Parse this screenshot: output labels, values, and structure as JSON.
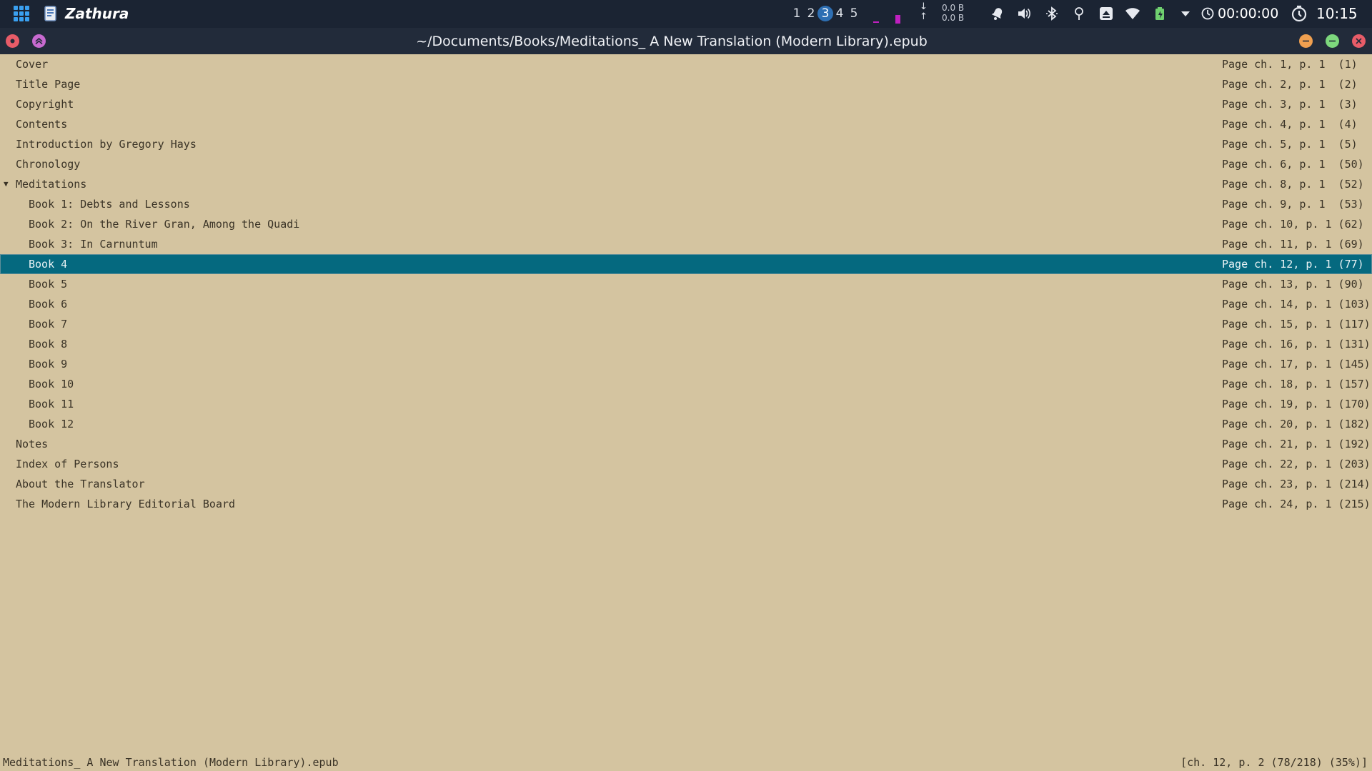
{
  "panel": {
    "app_name": "Zathura",
    "workspaces": [
      {
        "label": "1",
        "active": false
      },
      {
        "label": "2",
        "active": false
      },
      {
        "label": "3",
        "active": true
      },
      {
        "label": "4",
        "active": false
      },
      {
        "label": "5",
        "active": false
      }
    ],
    "net_down": "0.0 B",
    "net_up": "0.0 B",
    "timer": "00:00:00",
    "clock": "10:15",
    "tray_icons": [
      "notification-bell-icon",
      "volume-icon",
      "bluetooth-icon",
      "location-icon",
      "storage-icon",
      "wifi-icon",
      "battery-icon",
      "tray-expand-icon"
    ]
  },
  "window": {
    "title": "~/Documents/Books/Meditations_ A New Translation (Modern Library).epub",
    "colors": {
      "close": "#e85c68",
      "maximize": "#7dd87d",
      "minimize": "#f0a050"
    }
  },
  "toc": [
    {
      "label": "Cover",
      "page": "Page ch. 1, p. 1  (1)",
      "level": 0
    },
    {
      "label": "Title Page",
      "page": "Page ch. 2, p. 1  (2)",
      "level": 0
    },
    {
      "label": "Copyright",
      "page": "Page ch. 3, p. 1  (3)",
      "level": 0
    },
    {
      "label": "Contents",
      "page": "Page ch. 4, p. 1  (4)",
      "level": 0
    },
    {
      "label": "Introduction by Gregory Hays",
      "page": "Page ch. 5, p. 1  (5)",
      "level": 0
    },
    {
      "label": "Chronology",
      "page": "Page ch. 6, p. 1  (50)",
      "level": 0
    },
    {
      "label": "Meditations",
      "page": "Page ch. 8, p. 1  (52)",
      "level": 0,
      "expanded": true
    },
    {
      "label": "Book 1: Debts and Lessons",
      "page": "Page ch. 9, p. 1  (53)",
      "level": 1
    },
    {
      "label": "Book 2: On the River Gran, Among the Quadi",
      "page": "Page ch. 10, p. 1 (62)",
      "level": 1
    },
    {
      "label": "Book 3: In Carnuntum",
      "page": "Page ch. 11, p. 1 (69)",
      "level": 1
    },
    {
      "label": "Book 4",
      "page": "Page ch. 12, p. 1 (77)",
      "level": 1,
      "selected": true
    },
    {
      "label": "Book 5",
      "page": "Page ch. 13, p. 1 (90)",
      "level": 1
    },
    {
      "label": "Book 6",
      "page": "Page ch. 14, p. 1 (103)",
      "level": 1
    },
    {
      "label": "Book 7",
      "page": "Page ch. 15, p. 1 (117)",
      "level": 1
    },
    {
      "label": "Book 8",
      "page": "Page ch. 16, p. 1 (131)",
      "level": 1
    },
    {
      "label": "Book 9",
      "page": "Page ch. 17, p. 1 (145)",
      "level": 1
    },
    {
      "label": "Book 10",
      "page": "Page ch. 18, p. 1 (157)",
      "level": 1
    },
    {
      "label": "Book 11",
      "page": "Page ch. 19, p. 1 (170)",
      "level": 1
    },
    {
      "label": "Book 12",
      "page": "Page ch. 20, p. 1 (182)",
      "level": 1
    },
    {
      "label": "Notes",
      "page": "Page ch. 21, p. 1 (192)",
      "level": 0
    },
    {
      "label": "Index of Persons",
      "page": "Page ch. 22, p. 1 (203)",
      "level": 0
    },
    {
      "label": "About the Translator",
      "page": "Page ch. 23, p. 1 (214)",
      "level": 0
    },
    {
      "label": "The Modern Library Editorial Board",
      "page": "Page ch. 24, p. 1 (215)",
      "level": 0
    }
  ],
  "status": {
    "filename": "Meditations_ A New Translation (Modern Library).epub",
    "position": "[ch. 12, p. 2 (78/218) (35%)]"
  }
}
